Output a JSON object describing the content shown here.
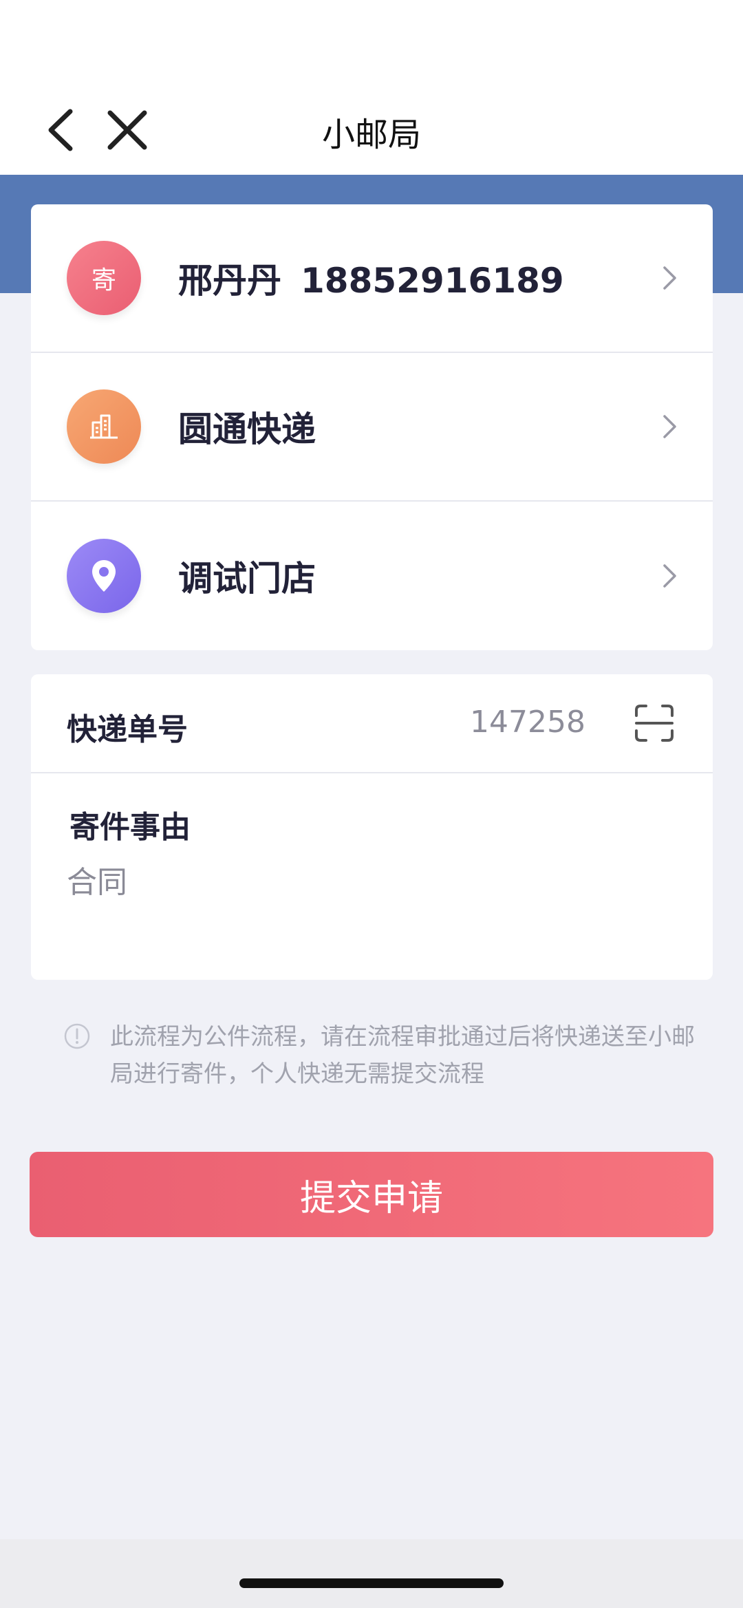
{
  "header": {
    "title": "小邮局"
  },
  "sender": {
    "icon_text": "寄",
    "name": "邢丹丹",
    "phone": "18852916189"
  },
  "courier": {
    "icon": "building-icon",
    "name": "圆通快递"
  },
  "store": {
    "icon": "location-pin-icon",
    "name": "调试门店"
  },
  "tracking": {
    "label": "快递单号",
    "value": "147258"
  },
  "reason": {
    "label": "寄件事由",
    "value": "合同"
  },
  "notice": {
    "text": "此流程为公件流程，请在流程审批通过后将快递送至小邮局进行寄件，个人快递无需提交流程"
  },
  "submit": {
    "label": "提交申请"
  },
  "colors": {
    "header_band": "#5679b5",
    "submit": "#ef6a78",
    "sender_icon": "#ef6d7e",
    "courier_icon": "#f2975f",
    "store_icon": "#8774ef"
  }
}
